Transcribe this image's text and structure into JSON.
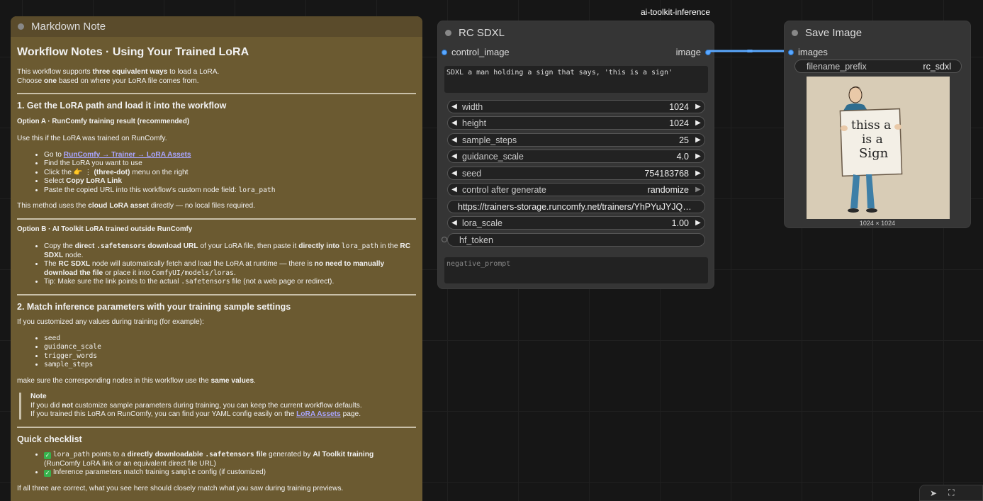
{
  "markdown_note": {
    "title": "Markdown Note",
    "h1": "Workflow Notes · Using Your Trained LoRA",
    "intro_1a": "This workflow supports ",
    "intro_1b": "three equivalent ways",
    "intro_1c": " to load a LoRA.",
    "intro_2a": "Choose ",
    "intro_2b": "one",
    "intro_2c": " based on where your LoRA file comes from.",
    "section1_title": "1. Get the LoRA path and load it into the workflow",
    "optionA_title": "Option A · RunComfy training result (recommended)",
    "optionA_intro": "Use this if the LoRA was trained on RunComfy.",
    "optionA_li1a": "Go to ",
    "optionA_li1_link": "RunComfy → Trainer → LoRA Assets",
    "optionA_li2": "Find the LoRA you want to use",
    "optionA_li3a": "Click the 👉 ⋮ ",
    "optionA_li3b": "(three-dot)",
    "optionA_li3c": " menu on the right",
    "optionA_li4a": "Select ",
    "optionA_li4b": "Copy LoRA Link",
    "optionA_li5a": "Paste the copied URL into this workflow's custom node field: ",
    "optionA_li5_code": "lora_path",
    "optionA_outro_a": "This method uses the ",
    "optionA_outro_b": "cloud LoRA asset",
    "optionA_outro_c": " directly — no local files required.",
    "optionB_title": "Option B · AI Toolkit LoRA trained outside RunComfy",
    "optionB_li1a": "Copy the ",
    "optionB_li1b": "direct ",
    "optionB_li1_code": ".safetensors",
    "optionB_li1c": " download URL",
    "optionB_li1d": " of your LoRA file, then paste it ",
    "optionB_li1e": "directly into ",
    "optionB_li1_code2": "lora_path",
    "optionB_li1f": " in the ",
    "optionB_li1g": "RC SDXL",
    "optionB_li1h": " node.",
    "optionB_li2a": "The ",
    "optionB_li2b": "RC SDXL",
    "optionB_li2c": " node will automatically fetch and load the LoRA at runtime — there is ",
    "optionB_li2d": "no need to manually download the file",
    "optionB_li2e": " or place it into ",
    "optionB_li2_code": "ComfyUI/models/loras",
    "optionB_li2f": ".",
    "optionB_li3a": "Tip: Make sure the link points to the actual ",
    "optionB_li3_code": ".safetensors",
    "optionB_li3b": " file (not a web page or redirect).",
    "section2_title": "2. Match inference parameters with your training sample settings",
    "section2_intro": "If you customized any values during training (for example):",
    "section2_items": [
      "seed",
      "guidance_scale",
      "trigger_words",
      "sample_steps"
    ],
    "section2_outro_a": "make sure the corresponding nodes in this workflow use the ",
    "section2_outro_b": "same values",
    "section2_outro_c": ".",
    "note_title": "Note",
    "note_l1a": "If you did ",
    "note_l1b": "not",
    "note_l1c": " customize sample parameters during training, you can keep the current workflow defaults.",
    "note_l2a": "If you trained this LoRA on RunComfy, you can find your YAML config easily on the ",
    "note_l2_link": "LoRA Assets",
    "note_l2b": " page.",
    "checklist_title": "Quick checklist",
    "check1_code": "lora_path",
    "check1a": " points to a ",
    "check1b": "directly downloadable ",
    "check1_code2": ".safetensors",
    "check1c": " file",
    "check1d": " generated by ",
    "check1e": "AI Toolkit training",
    "check1f": "(RunComfy LoRA link or an equivalent direct file URL)",
    "check2a": "Inference parameters match training ",
    "check2_code": "sample",
    "check2b": " config (if customized)",
    "final": "If all three are correct, what you see here should closely match what you saw during training previews."
  },
  "group_label": "ai-toolkit-inference",
  "rc_sdxl": {
    "title": "RC SDXL",
    "input_label": "control_image",
    "output_label": "image",
    "prompt": "SDXL a man holding a sign that says, 'this is a sign'",
    "negative_placeholder": "negative_prompt",
    "widgets": {
      "width": {
        "label": "width",
        "value": "1024"
      },
      "height": {
        "label": "height",
        "value": "1024"
      },
      "sample_steps": {
        "label": "sample_steps",
        "value": "25"
      },
      "guidance_scale": {
        "label": "guidance_scale",
        "value": "4.0"
      },
      "seed": {
        "label": "seed",
        "value": "754183768"
      },
      "control_after_generate": {
        "label": "control after generate",
        "value": "randomize"
      },
      "lora_path": {
        "value": "https://trainers-storage.runcomfy.net/trainers/YhPYuJYJQ…"
      },
      "lora_scale": {
        "label": "lora_scale",
        "value": "1.00"
      },
      "hf_token": {
        "label": "hf_token"
      }
    }
  },
  "save_image": {
    "title": "Save Image",
    "input_label": "images",
    "filename_prefix_label": "filename_prefix",
    "filename_prefix_value": "rc_sdxl",
    "image_caption": "1024 × 1024",
    "sign_text": [
      "thiss a",
      "is a",
      "Sign"
    ]
  },
  "colors": {
    "canvas": "#161616",
    "note_bg": "#6b5a31",
    "node_bg": "#353535",
    "link": "#5aa8ff"
  }
}
